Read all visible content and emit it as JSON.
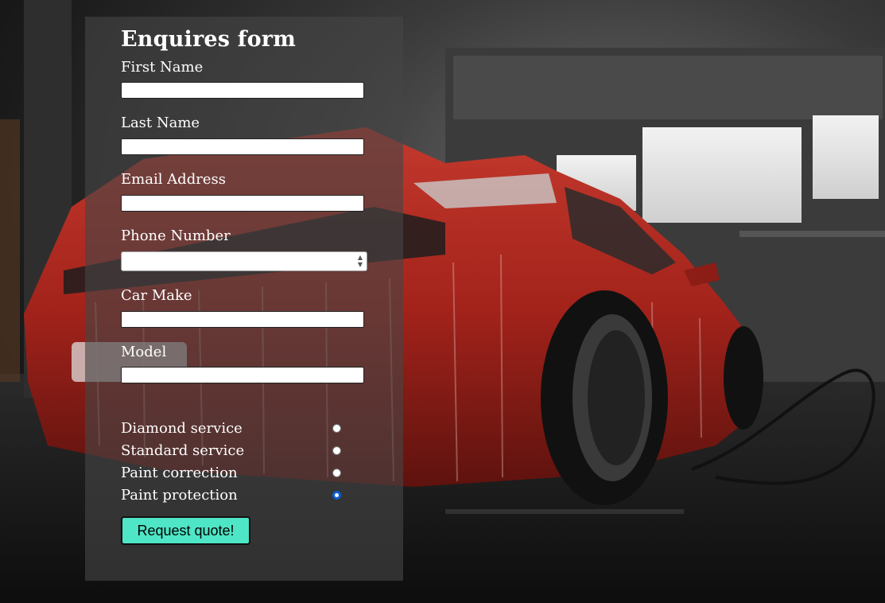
{
  "form": {
    "title": "Enquires form",
    "fields": [
      {
        "label": "First Name",
        "value": "",
        "type": "text"
      },
      {
        "label": "Last Name",
        "value": "",
        "type": "text"
      },
      {
        "label": "Email Address",
        "value": "",
        "type": "email"
      },
      {
        "label": "Phone Number",
        "value": "",
        "type": "number"
      },
      {
        "label": "Car Make",
        "value": "",
        "type": "text"
      },
      {
        "label": "Model",
        "value": "",
        "type": "text"
      }
    ],
    "services": [
      {
        "label": "Diamond service",
        "checked": false
      },
      {
        "label": "Standard service",
        "checked": false
      },
      {
        "label": "Paint correction",
        "checked": false
      },
      {
        "label": "Paint protection",
        "checked": true
      }
    ],
    "submit_label": "Request quote!"
  },
  "colors": {
    "panel_bg": "#464646",
    "submit_bg": "#4ee6c6",
    "radio_selected": "#0a5fd0",
    "car_red": "#a3231b"
  },
  "icons": {
    "spinner": "number-spinner-icon"
  }
}
